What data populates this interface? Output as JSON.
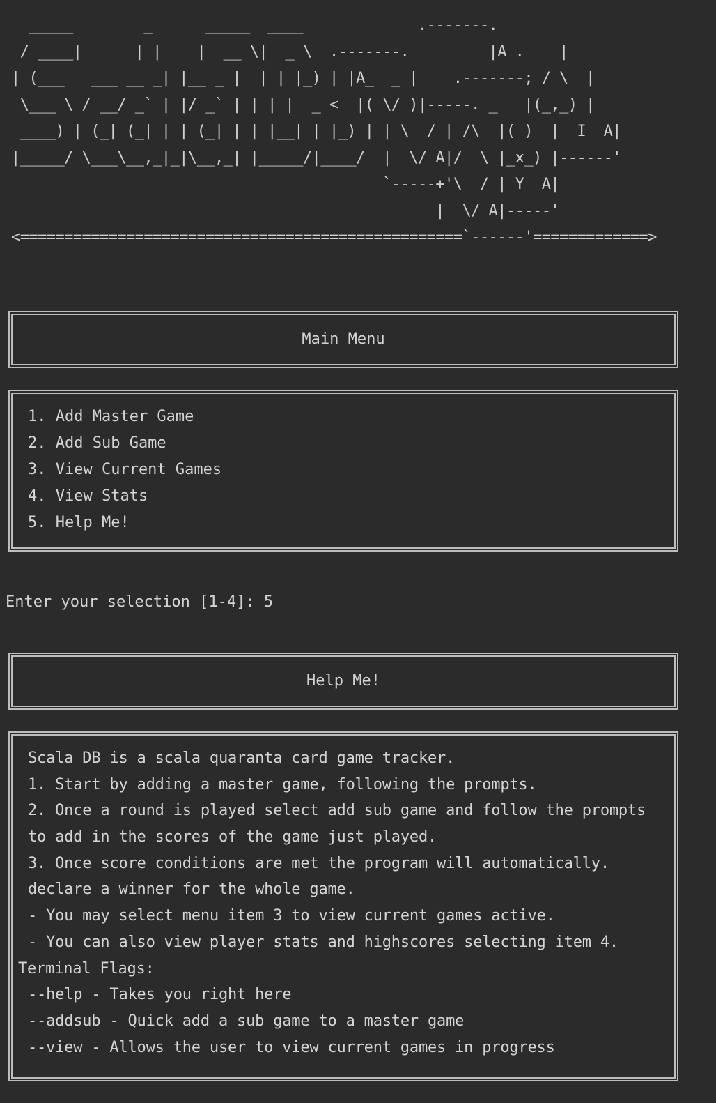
{
  "ascii_banner": "  _____        _      _____  ____             .-------.\n / ____|      | |    |  __ \\|  _ \\  .-------.         |A .    |\n| (___   ___ __ _| |__ _ |  | | |_) | |A_  _ |    .-------; / \\  |\n \\___ \\ / __/ _` | |/ _` | | | |  _ <  |( \\/ )|-----. _   |(_,_) |\n ____) | (_| (_| | | (_| | | |__| | |_) | | \\  / | /\\  |( )  |  I  A|\n|_____/ \\___\\__,_|_|\\__,_| |_____/|____/  |  \\/ A|/  \\ |_x_) |------'\n                                          `-----+'\\  / | Y  A|\n                                                |  \\/ A|-----'\n<==================================================`------'=============>",
  "main_menu": {
    "title": "Main Menu",
    "items": [
      "1. Add Master Game",
      "2. Add Sub Game",
      "3. View Current Games",
      "4. View Stats",
      "5. Help Me!"
    ]
  },
  "prompt": {
    "text": "Enter your selection [1-4]: ",
    "value": "5"
  },
  "help": {
    "title": "Help Me!",
    "lines": [
      "Scala DB is a scala quaranta card game tracker.",
      "1. Start by adding a master game, following the prompts.",
      "2. Once a round is played select add sub game and follow the prompts",
      "to add in the scores of the game just played.",
      "3. Once score conditions are met the program will automatically.",
      "declare a winner for the whole game.",
      "- You may select menu item 3 to view current games active.",
      "- You can also view player stats and highscores selecting item 4."
    ],
    "flags_title": "Terminal Flags:",
    "flags": [
      "--help - Takes you right here",
      "--addsub - Quick add a sub game to a master game",
      "--view - Allows the user to view current games in progress"
    ]
  },
  "colors": {
    "background": "#2b2b2b",
    "text": "#d4d4d4",
    "border": "#bdbdbd"
  }
}
